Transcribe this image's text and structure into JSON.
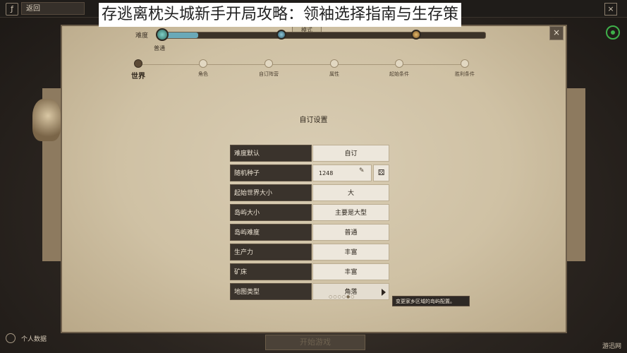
{
  "overlay_title": "存逃离枕头城新手开局攻略：领袖选择指南与生存策",
  "topbar": {
    "back_label": "返回",
    "close_label": "×"
  },
  "difficulty": {
    "label": "难度",
    "value": "普通",
    "mode_tab": "模式",
    "level_fraction": 0.11
  },
  "steps": [
    {
      "label": "世界",
      "active": true
    },
    {
      "label": "角色",
      "active": false
    },
    {
      "label": "自订阵营",
      "active": false
    },
    {
      "label": "属性",
      "active": false
    },
    {
      "label": "起始条件",
      "active": false
    },
    {
      "label": "胜利条件",
      "active": false
    }
  ],
  "section_title": "自订设置",
  "settings": [
    {
      "key": "难度默认",
      "value": "自订"
    },
    {
      "key": "随机种子",
      "value": "1248"
    },
    {
      "key": "起始世界大小",
      "value": "大"
    },
    {
      "key": "岛屿大小",
      "value": "主要是大型"
    },
    {
      "key": "岛屿难度",
      "value": "普通"
    },
    {
      "key": "生产力",
      "value": "丰富"
    },
    {
      "key": "矿床",
      "value": "丰富"
    },
    {
      "key": "地图类型",
      "value": "角落"
    }
  ],
  "seed_edit_icon": "✎",
  "seed_random_icon": "⚄",
  "tooltip": "变更家乡区域的岛屿配置。",
  "pager": "○○○○●○",
  "start_button": "开始游戏",
  "profile_label": "个人数据",
  "watermark": "游迅网",
  "panel_close": "×"
}
